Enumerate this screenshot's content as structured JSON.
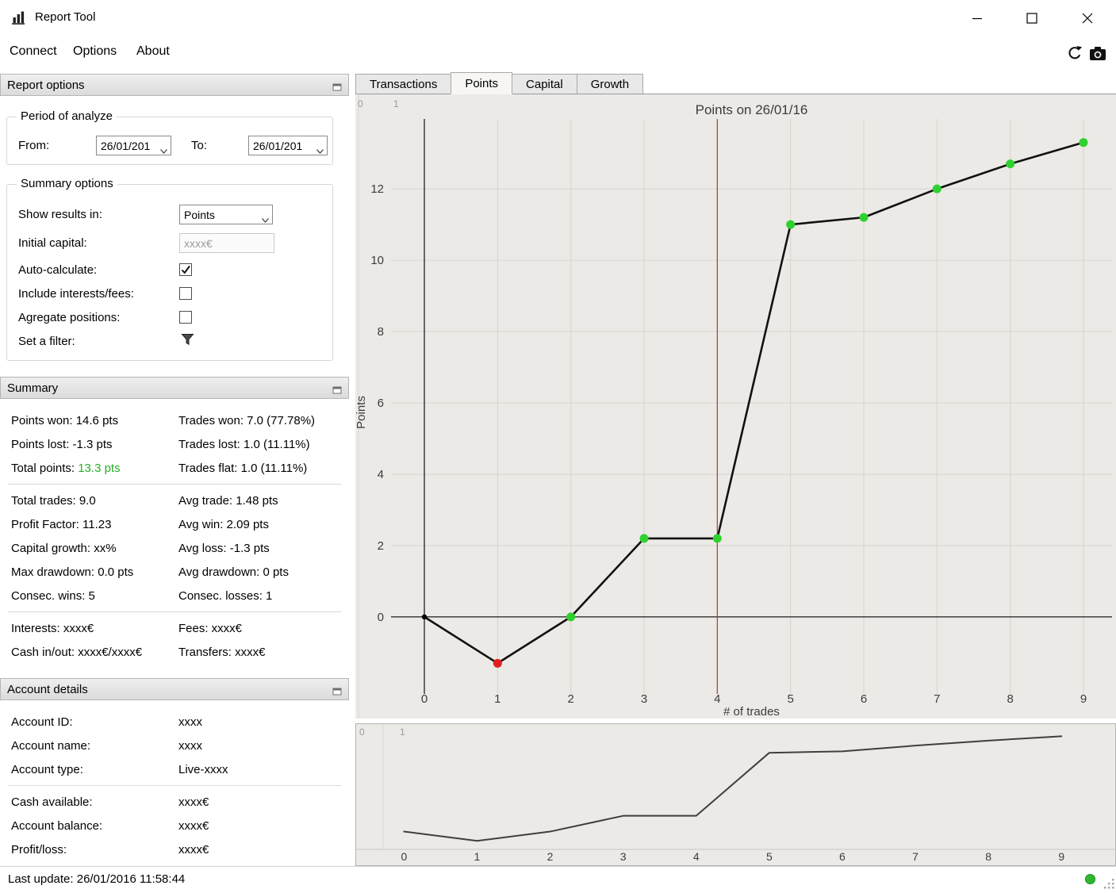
{
  "window": {
    "title": "Report Tool",
    "controls": {
      "minimize": "minimize",
      "maximize": "maximize",
      "close": "close"
    }
  },
  "menubar": {
    "items": [
      {
        "label": "Connect"
      },
      {
        "label": "Options"
      },
      {
        "label": "About"
      }
    ]
  },
  "report_options": {
    "title": "Report options",
    "period": {
      "title": "Period of analyze",
      "from_label": "From:",
      "from_value": "26/01/201",
      "to_label": "To:",
      "to_value": "26/01/201"
    },
    "summary_options": {
      "title": "Summary options",
      "rows": {
        "show_results_label": "Show results in:",
        "show_results_value": "Points",
        "initial_capital_label": "Initial capital:",
        "initial_capital_placeholder": "xxxx€",
        "auto_calculate_label": "Auto-calculate:",
        "include_fees_label": "Include interests/fees:",
        "agregate_label": "Agregate positions:",
        "filter_label": "Set a filter:"
      },
      "auto_calculate_checked": true,
      "include_fees_checked": false,
      "agregate_checked": false
    }
  },
  "summary": {
    "title": "Summary",
    "total_points_label": "Total points: ",
    "total_points_value": "13.3 pts",
    "groups": [
      {
        "rows": [
          {
            "left": "Points won: 14.6 pts",
            "right": "Trades won: 7.0 (77.78%)"
          },
          {
            "left": "Points lost: -1.3 pts",
            "right": "Trades lost: 1.0 (11.11%)"
          },
          {
            "left": "",
            "right": "Trades flat: 1.0 (11.11%)"
          }
        ]
      },
      {
        "rows": [
          {
            "left": "Total trades: 9.0",
            "right": "Avg trade: 1.48 pts"
          },
          {
            "left": "Profit Factor: 11.23",
            "right": "Avg win: 2.09 pts"
          },
          {
            "left": "Capital growth: xx%",
            "right": "Avg loss: -1.3 pts"
          },
          {
            "left": "Max drawdown: 0.0 pts",
            "right": "Avg drawdown: 0 pts"
          },
          {
            "left": "Consec. wins: 5",
            "right": "Consec. losses: 1"
          }
        ]
      },
      {
        "rows": [
          {
            "left": "Interests: xxxx€",
            "right": "Fees: xxxx€"
          },
          {
            "left": "Cash in/out: xxxx€/xxxx€",
            "right": "Transfers: xxxx€"
          }
        ]
      }
    ]
  },
  "account": {
    "title": "Account details",
    "rows": [
      {
        "label": "Account ID:",
        "value": "xxxx"
      },
      {
        "label": "Account name:",
        "value": "xxxx"
      },
      {
        "label": "Account type:",
        "value": "Live-xxxx"
      },
      {
        "label": "Cash available:",
        "value": "xxxx€"
      },
      {
        "label": "Account balance:",
        "value": "xxxx€"
      },
      {
        "label": "Profit/loss:",
        "value": "xxxx€"
      }
    ]
  },
  "statusbar": {
    "last_update": "Last update: 26/01/2016 11:58:44"
  },
  "tabs": [
    {
      "label": "Transactions",
      "active": false
    },
    {
      "label": "Points",
      "active": true
    },
    {
      "label": "Capital",
      "active": false
    },
    {
      "label": "Growth",
      "active": false
    }
  ],
  "colors": {
    "positive_text_green": "#22b122",
    "marker_green": "#2fd12f",
    "marker_red": "#e02020",
    "cursor_line_red": "#b03a3a",
    "status_dot_green": "#2eb82e",
    "chart_background": "#eceae6"
  },
  "chart_data": [
    {
      "type": "line",
      "title": "Points on 26/01/16",
      "xlabel": "# of trades",
      "ylabel": "Points",
      "x": [
        0,
        1,
        2,
        3,
        4,
        5,
        6,
        7,
        8,
        9
      ],
      "values": [
        0.0,
        -1.3,
        0.0,
        2.2,
        2.2,
        11.0,
        11.2,
        12.0,
        12.7,
        13.3
      ],
      "marker_colors": [
        "#000000",
        "#e02020",
        "#2fd12f",
        "#2fd12f",
        "#2fd12f",
        "#2fd12f",
        "#2fd12f",
        "#2fd12f",
        "#2fd12f",
        "#2fd12f"
      ],
      "xticks": [
        0,
        1,
        2,
        3,
        4,
        5,
        6,
        7,
        8,
        9
      ],
      "yticks": [
        0,
        2,
        4,
        6,
        8,
        10,
        12
      ],
      "xlim": [
        -0.455,
        9.39
      ],
      "ylim": [
        -2.16,
        13.96
      ],
      "grid": true,
      "zero_lines": true,
      "vline_x": 4,
      "corner_labels": [
        "0",
        "1"
      ],
      "legend": "none"
    },
    {
      "type": "line",
      "title": "",
      "xlabel": "",
      "ylabel": "",
      "x": [
        0,
        1,
        2,
        3,
        4,
        5,
        6,
        7,
        8,
        9
      ],
      "values": [
        0.0,
        -1.3,
        0.0,
        2.2,
        2.2,
        11.0,
        11.2,
        12.0,
        12.7,
        13.3
      ],
      "xticks": [
        0,
        1,
        2,
        3,
        4,
        5,
        6,
        7,
        8,
        9
      ],
      "yticks": [],
      "xlim": [
        -0.46,
        9.66
      ],
      "ylim": [
        -1.6,
        13.9
      ],
      "grid": false,
      "zero_lines": false,
      "corner_labels": [
        "0",
        "1"
      ],
      "legend": "none"
    }
  ]
}
